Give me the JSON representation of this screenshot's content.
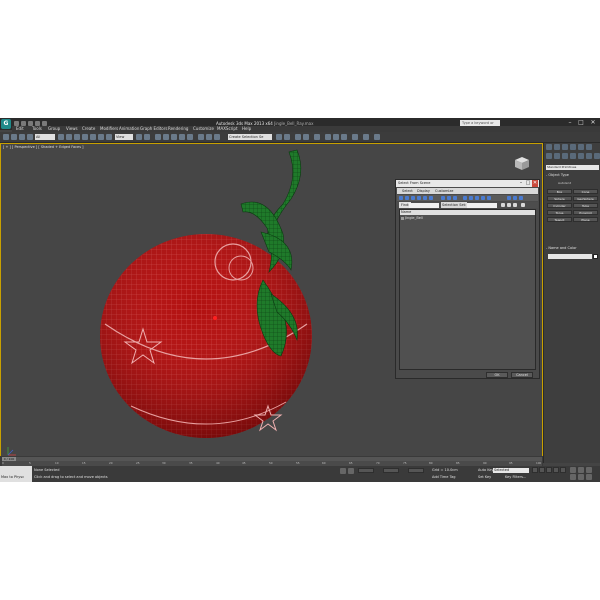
{
  "window": {
    "title_main": "Autodesk 3ds Max  2013 x64",
    "title_file": "Jingle_Bell_Ray.max",
    "logo_text": "G",
    "help_search_placeholder": "Type a keyword or phrase",
    "minimize": "–",
    "maximize": "□",
    "close": "✕"
  },
  "menu": [
    "Edit",
    "Tools",
    "Group",
    "Views",
    "Create",
    "Modifiers",
    "Animation",
    "Graph Editors",
    "Rendering",
    "Customize",
    "MAXScript",
    "Help"
  ],
  "toolbar": {
    "selection_filter": "All",
    "view_dropdown": "View",
    "named_selection": "Create Selection Se"
  },
  "viewport": {
    "label": "[ + ] [ Perspective ] [ Shaded + Edged Faces ]"
  },
  "command_panel": {
    "category": "Standard Primitives",
    "object_type_title": "- Object Type",
    "autogrid": "AutoGrid",
    "buttons": [
      "Box",
      "Cone",
      "Sphere",
      "GeoSphere",
      "Cylinder",
      "Tube",
      "Torus",
      "Pyramid",
      "Teapot",
      "Plane"
    ],
    "name_color_title": "- Name and Color"
  },
  "dialog": {
    "title": "Select From Scene",
    "menu": [
      "Select",
      "Display",
      "Customize"
    ],
    "find_label": "Find:",
    "selection_set_label": "Selection Set:",
    "column_name": "Name",
    "items": [
      "Jingle_Bell"
    ],
    "ok": "OK",
    "cancel": "Cancel"
  },
  "timeline": {
    "current": "0 / 100",
    "ticks": [
      "0",
      "5",
      "10",
      "15",
      "20",
      "25",
      "30",
      "35",
      "40",
      "45",
      "50",
      "55",
      "60",
      "65",
      "70",
      "75",
      "80",
      "85",
      "90",
      "95",
      "100"
    ]
  },
  "status": {
    "maxscript_label": "Max to Physc",
    "selection": "None Selected",
    "prompt": "Click and drag to select and move objects",
    "grid": "Grid = 10.0cm",
    "add_time_tag": "Add Time Tag",
    "autokey": "Auto Key",
    "autokey_mode": "Selected",
    "setkey": "Set Key",
    "key_filters": "Key Filters..."
  },
  "colors": {
    "viewport_bg": "#464646",
    "bell_red": "#b01010",
    "ribbon_green": "#1f7a2a",
    "active_border": "#c8a000"
  }
}
